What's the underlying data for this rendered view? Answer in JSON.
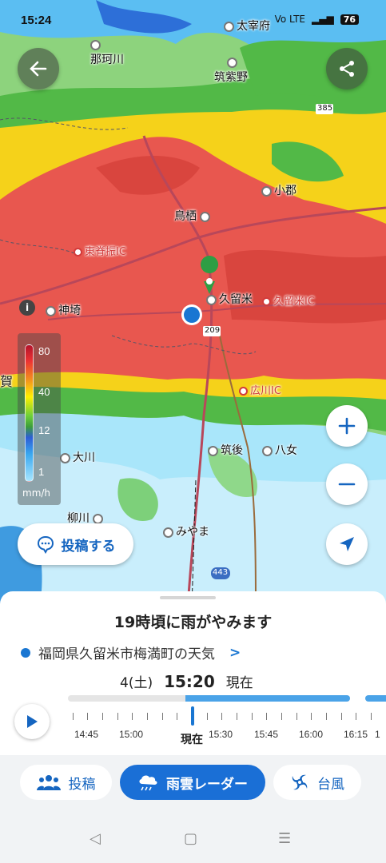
{
  "status_bar": {
    "time": "15:24",
    "battery": "76",
    "network": "Vo LTE"
  },
  "map": {
    "places": [
      {
        "name": "那珂川",
        "type": "city"
      },
      {
        "name": "筑紫野",
        "type": "city"
      },
      {
        "name": "小郡",
        "type": "city"
      },
      {
        "name": "鳥栖",
        "type": "city"
      },
      {
        "name": "東脊振IC",
        "type": "ic"
      },
      {
        "name": "神埼",
        "type": "city"
      },
      {
        "name": "久留米",
        "type": "city"
      },
      {
        "name": "久留米IC",
        "type": "ic"
      },
      {
        "name": "広川IC",
        "type": "ic"
      },
      {
        "name": "筑後",
        "type": "city"
      },
      {
        "name": "八女",
        "type": "city"
      },
      {
        "name": "大川",
        "type": "city"
      },
      {
        "name": "柳川",
        "type": "city"
      },
      {
        "name": "みやま",
        "type": "city"
      },
      {
        "name": "太宰府",
        "type": "city"
      },
      {
        "name": "賀",
        "type": "edge"
      }
    ],
    "road_numbers": [
      "209",
      "443",
      "385"
    ],
    "legend": {
      "levels": [
        "80",
        "40",
        "12",
        "1"
      ],
      "unit": "mm/h"
    },
    "info_label": "i"
  },
  "buttons": {
    "post_label": "投稿する"
  },
  "colors": {
    "accent": "#1a6fd6",
    "pin": "#2e9e44",
    "location_dot": "#1976d2"
  },
  "forecast": {
    "headline": "19時頃に雨がやみます",
    "location": "福岡県久留米市梅満町の天気",
    "date": "4(土)",
    "time": "15:20",
    "now_text": "現在"
  },
  "timeline": {
    "labels": [
      "14:45",
      "15:00",
      "15:30",
      "15:45",
      "16:00",
      "16:15"
    ],
    "cursor_label": "現在",
    "cropped_label": "1"
  },
  "tabs": [
    {
      "label": "投稿",
      "icon": "people-icon",
      "active": false
    },
    {
      "label": "雨雲レーダー",
      "icon": "rain-cloud-icon",
      "active": true
    },
    {
      "label": "台風",
      "icon": "typhoon-icon",
      "active": false
    }
  ]
}
